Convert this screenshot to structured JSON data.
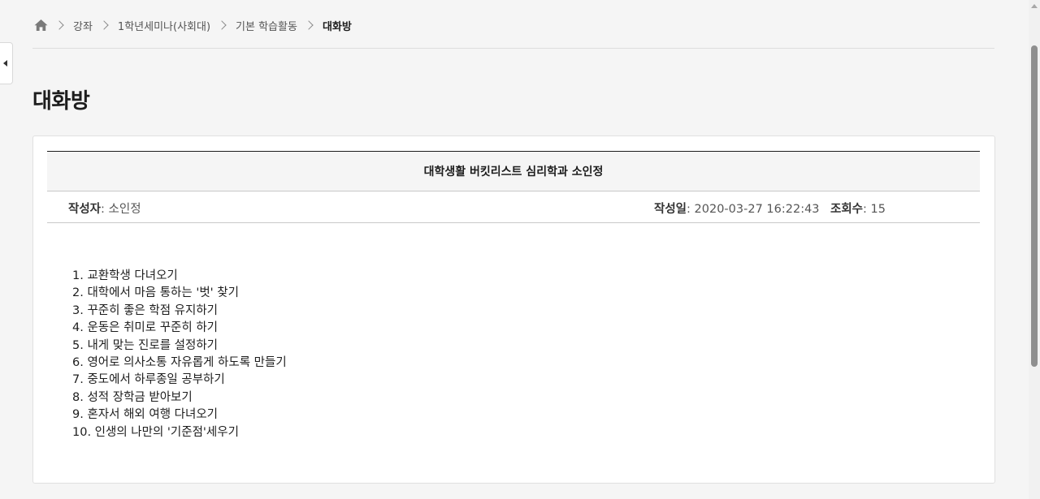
{
  "breadcrumb": {
    "home_icon": "home-icon",
    "items": [
      "강좌",
      "1학년세미나(사회대)",
      "기본 학습활동"
    ],
    "current": "대화방"
  },
  "page": {
    "title": "대화방"
  },
  "post": {
    "title": "대학생활 버킷리스트 심리학과 소인정",
    "author_label": "작성자",
    "author": "소인정",
    "date_label": "작성일",
    "date": "2020-03-27 16:22:43",
    "views_label": "조회수",
    "views": "15",
    "body": [
      "1. 교환학생 다녀오기",
      "2. 대학에서 마음 통하는 '벗' 찾기",
      "3. 꾸준히 좋은 학점 유지하기",
      "4. 운동은 취미로 꾸준히 하기",
      "5. 내게 맞는 진로를 설정하기",
      "6. 영어로 의사소통 자유롭게 하도록 만들기",
      "7. 중도에서 하루종일 공부하기",
      "8. 성적 장학금 받아보기",
      "9. 혼자서 해외 여행 다녀오기",
      "10. 인생의 나만의 '기준점'세우기"
    ]
  },
  "colors": {
    "background": "#f5f5f5",
    "card": "#ffffff",
    "text": "#1d1d1d",
    "muted": "#555555"
  }
}
